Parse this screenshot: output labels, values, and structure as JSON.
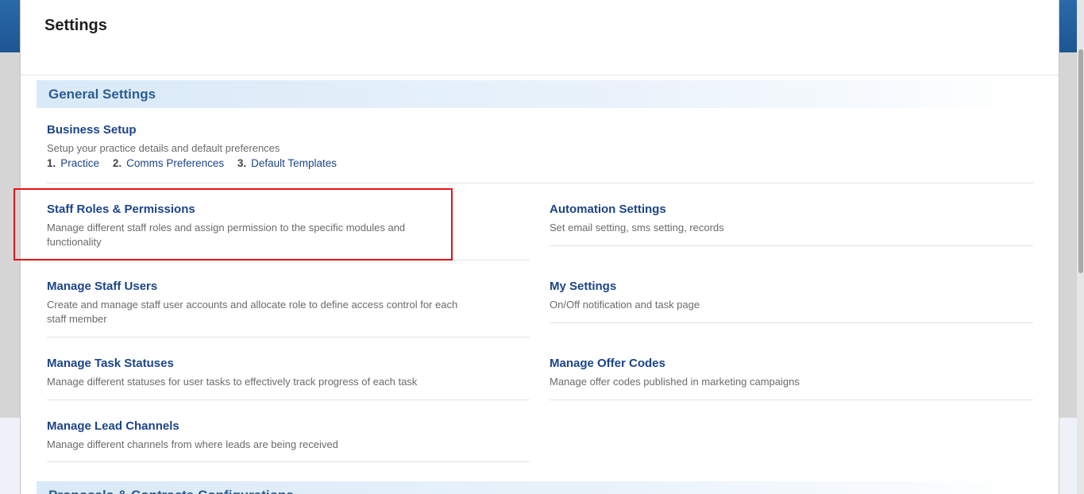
{
  "page": {
    "title": "Settings"
  },
  "sections": [
    {
      "title": "General Settings"
    },
    {
      "title": "Proposals & Contracts Configurations"
    }
  ],
  "business_setup": {
    "title": "Business Setup",
    "description": "Setup your practice details and default preferences",
    "links": [
      {
        "num": "1.",
        "label": "Practice"
      },
      {
        "num": "2.",
        "label": "Comms Preferences"
      },
      {
        "num": "3.",
        "label": "Default Templates"
      }
    ]
  },
  "items": {
    "staff_roles": {
      "title": "Staff Roles & Permissions",
      "description": "Manage different staff roles and assign permission to the specific modules and functionality"
    },
    "automation": {
      "title": "Automation Settings",
      "description": "Set email setting, sms setting, records"
    },
    "staff_users": {
      "title": "Manage Staff Users",
      "description": "Create and manage staff user accounts and allocate role to define access control for each staff member"
    },
    "my_settings": {
      "title": "My Settings",
      "description": "On/Off notification and task page"
    },
    "task_statuses": {
      "title": "Manage Task Statuses",
      "description": "Manage different statuses for user tasks to effectively track progress of each task"
    },
    "offer_codes": {
      "title": "Manage Offer Codes",
      "description": "Manage offer codes published in marketing campaigns"
    },
    "lead_channels": {
      "title": "Manage Lead Channels",
      "description": "Manage different channels from where leads are being received"
    }
  },
  "colors": {
    "link": "#1c4587",
    "section_title": "#2a5d8f",
    "highlight": "#e0141c"
  }
}
